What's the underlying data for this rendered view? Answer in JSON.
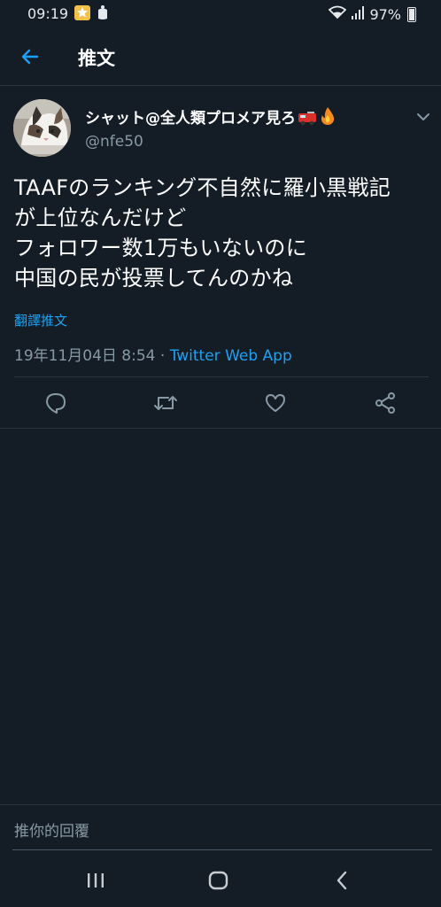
{
  "status_bar": {
    "time": "09:19",
    "battery": "97%",
    "icons": [
      "notification-icon",
      "app-icon",
      "wifi-icon",
      "signal-icon",
      "battery-icon"
    ]
  },
  "header": {
    "title": "推文",
    "back_icon": "arrow-left-icon"
  },
  "tweet": {
    "display_name": "シャット@全人類プロメア見ろ",
    "name_emojis": [
      "fire-engine-emoji",
      "fire-emoji"
    ],
    "handle": "@nfe50",
    "text_lines": [
      "TAAFのランキング不自然に羅小黒戦記",
      "が上位なんだけど",
      "フォロワー数1万もいないのに",
      "中国の民が投票してんのかね"
    ],
    "translate_label": "翻譯推文",
    "timestamp": "19年11月04日 8:54 · ",
    "source": "Twitter Web App",
    "actions": [
      "reply-icon",
      "retweet-icon",
      "like-icon",
      "share-icon"
    ]
  },
  "reply": {
    "placeholder": "推你的回覆"
  },
  "nav": [
    "recent-apps-icon",
    "home-icon",
    "back-icon"
  ],
  "colors": {
    "background": "#141d26",
    "accent": "#1da1f2",
    "secondary_text": "#8899a6",
    "divider": "#2a3542"
  }
}
